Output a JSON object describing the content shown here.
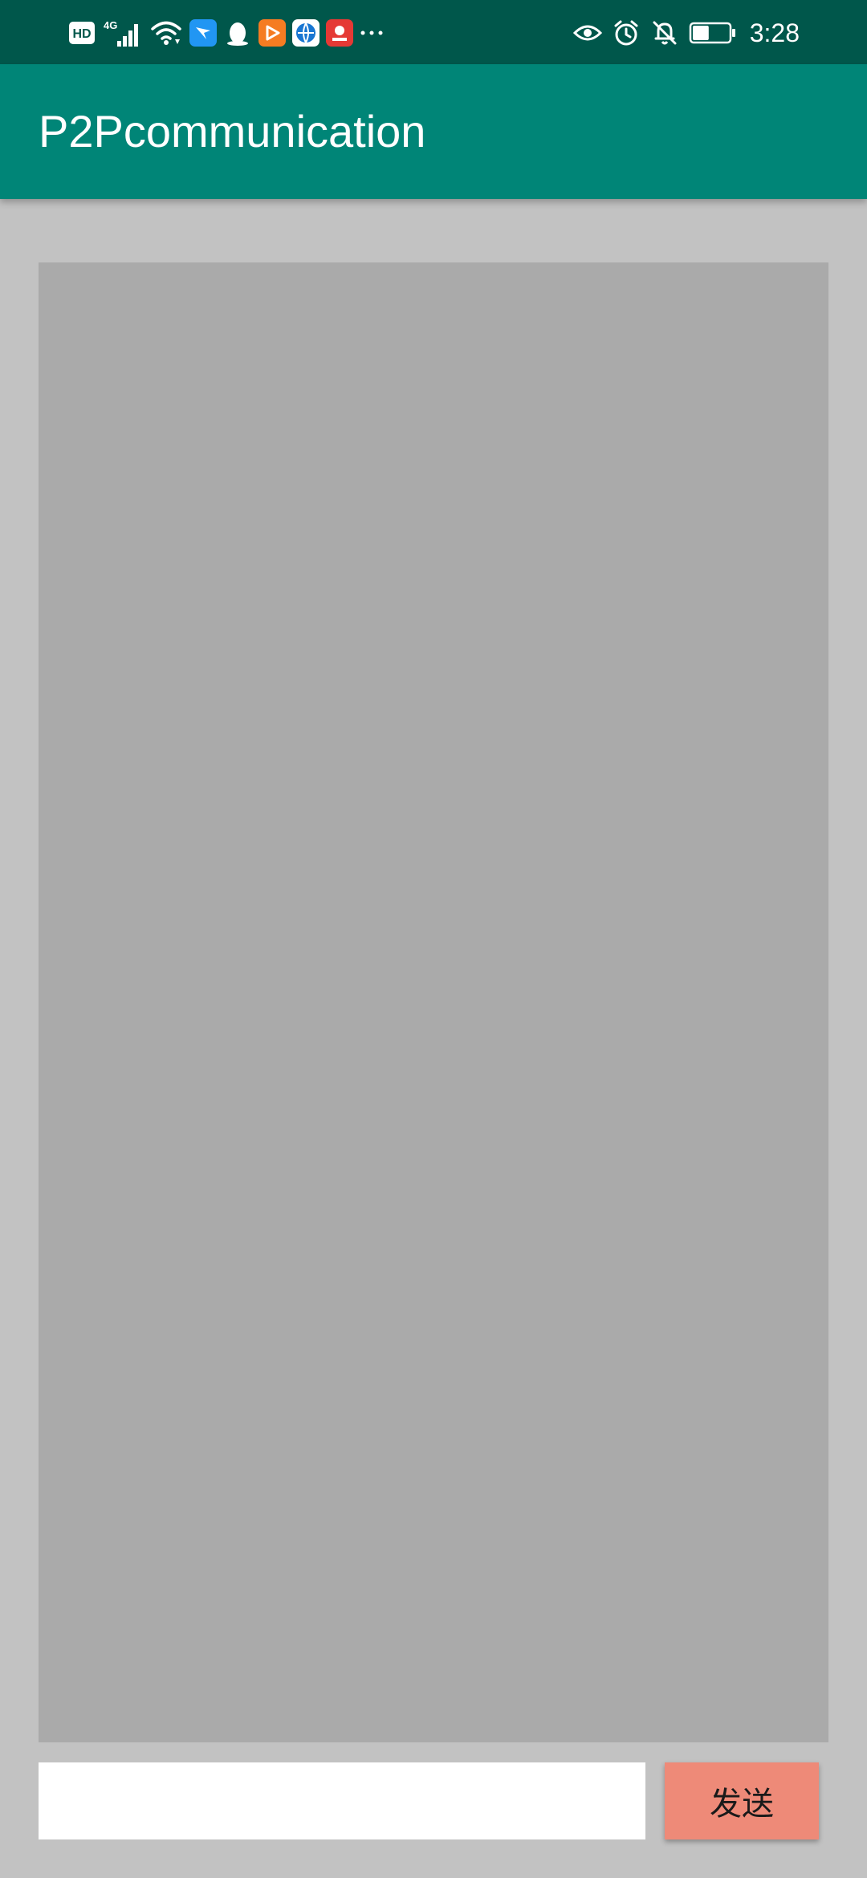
{
  "status_bar": {
    "time": "3:28",
    "network_label": "4G",
    "hd_label": "HD",
    "more_label": "···",
    "left_icons": [
      "hd-icon",
      "signal-4g-icon",
      "wifi-icon",
      "app-blue-bird-icon",
      "qq-penguin-icon",
      "app-orange-play-icon",
      "app-globe-icon",
      "app-red-icon",
      "more-icon"
    ],
    "right_icons": [
      "eye-icon",
      "alarm-icon",
      "bell-off-icon",
      "battery-icon"
    ],
    "colors": {
      "background": "#00574b",
      "icon": "#ffffff"
    },
    "battery_level": 0.45
  },
  "app_bar": {
    "title": "P2Pcommunication",
    "color": "#008577"
  },
  "chat": {
    "messages": [],
    "area_color": "#aaaaaa"
  },
  "composer": {
    "input_value": "",
    "input_placeholder": "",
    "send_label": "发送",
    "send_color": "#ee8a78"
  },
  "colors": {
    "page_background": "#c2c2c2"
  }
}
